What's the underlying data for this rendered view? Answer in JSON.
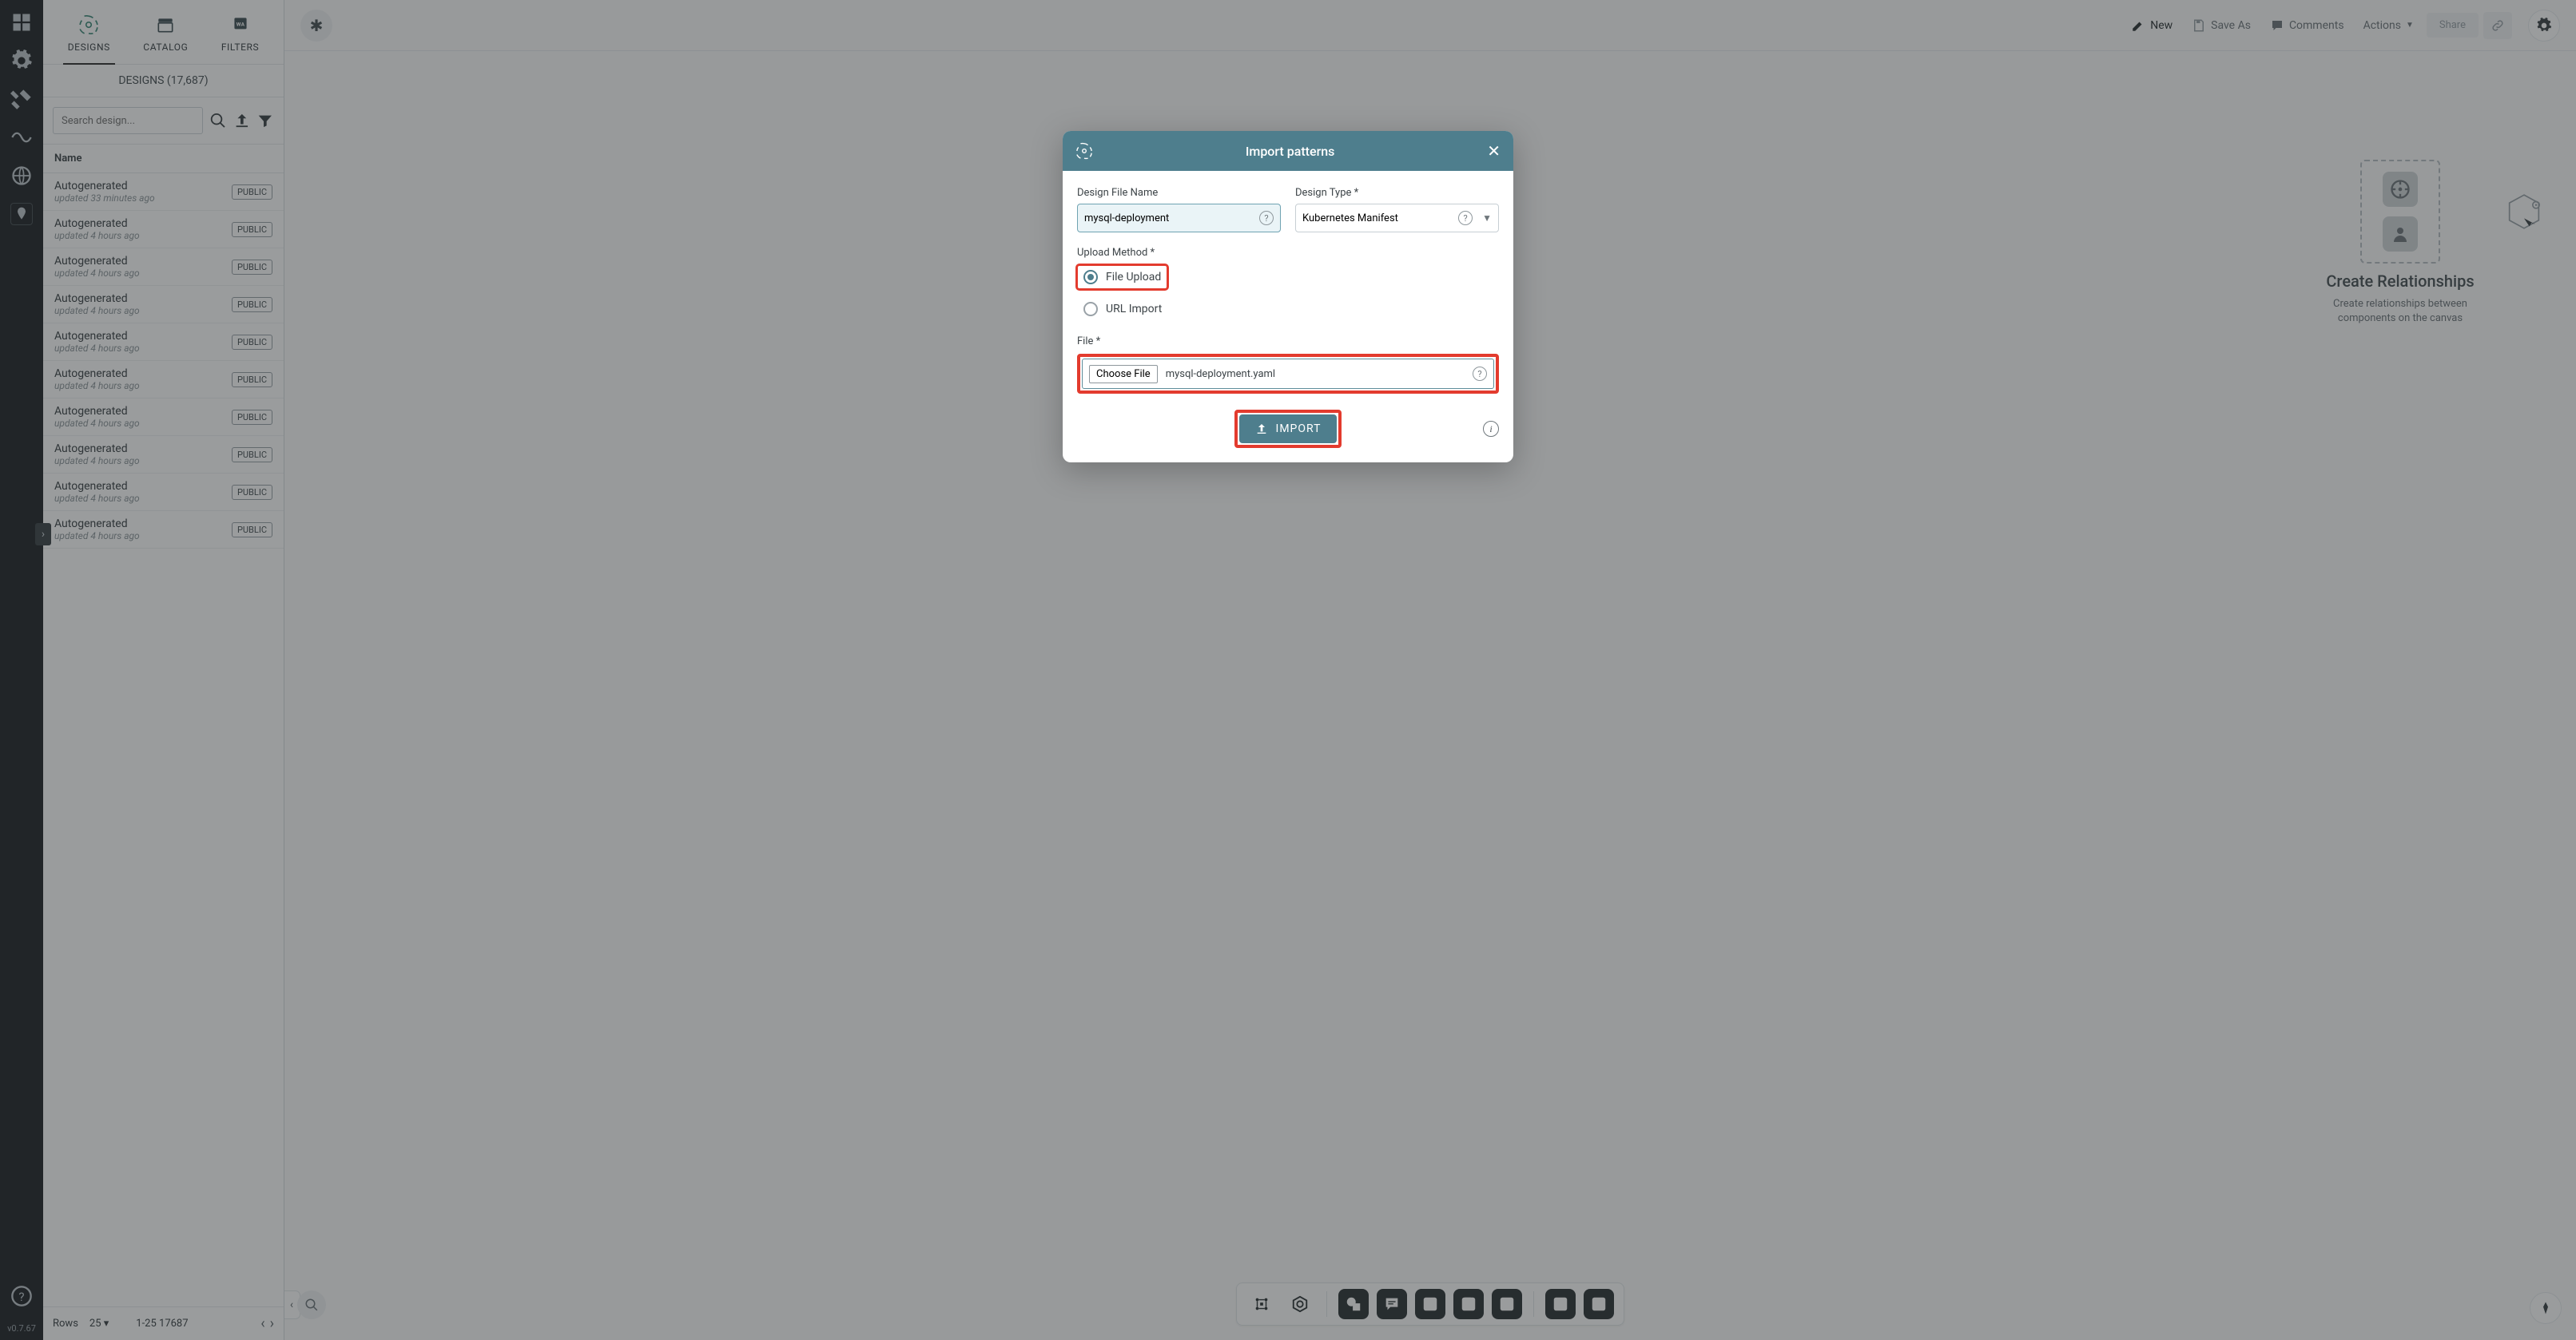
{
  "rail": {
    "version": "v0.7.67"
  },
  "leftPanel": {
    "tabs": {
      "designs": "DESIGNS",
      "catalog": "CATALOG",
      "filters": "FILTERS"
    },
    "countLabel": "DESIGNS (17,687)",
    "searchPlaceholder": "Search design...",
    "listHeader": "Name",
    "items": [
      {
        "name": "Autogenerated",
        "sub": "updated 33 minutes ago",
        "badge": "PUBLIC"
      },
      {
        "name": "Autogenerated",
        "sub": "updated 4 hours ago",
        "badge": "PUBLIC"
      },
      {
        "name": "Autogenerated",
        "sub": "updated 4 hours ago",
        "badge": "PUBLIC"
      },
      {
        "name": "Autogenerated",
        "sub": "updated 4 hours ago",
        "badge": "PUBLIC"
      },
      {
        "name": "Autogenerated",
        "sub": "updated 4 hours ago",
        "badge": "PUBLIC"
      },
      {
        "name": "Autogenerated",
        "sub": "updated 4 hours ago",
        "badge": "PUBLIC"
      },
      {
        "name": "Autogenerated",
        "sub": "updated 4 hours ago",
        "badge": "PUBLIC"
      },
      {
        "name": "Autogenerated",
        "sub": "updated 4 hours ago",
        "badge": "PUBLIC"
      },
      {
        "name": "Autogenerated",
        "sub": "updated 4 hours ago",
        "badge": "PUBLIC"
      },
      {
        "name": "Autogenerated",
        "sub": "updated 4 hours ago",
        "badge": "PUBLIC"
      }
    ],
    "footer": {
      "rowsLabel": "Rows",
      "rowsValue": "25",
      "range": "1-25 17687"
    }
  },
  "topbar": {
    "new": "New",
    "saveAs": "Save As",
    "comments": "Comments",
    "actions": "Actions",
    "share": "Share"
  },
  "hint": {
    "title": "Create Relationships",
    "body": "Create relationships between components on the canvas"
  },
  "modal": {
    "title": "Import patterns",
    "fileNameLabel": "Design File Name",
    "fileNameValue": "mysql-deployment",
    "typeLabel": "Design Type *",
    "typeValue": "Kubernetes Manifest",
    "uploadMethodLabel": "Upload Method *",
    "radioFile": "File Upload",
    "radioUrl": "URL Import",
    "fileLabel": "File *",
    "chooseFile": "Choose File",
    "chosenFile": "mysql-deployment.yaml",
    "importBtn": "IMPORT"
  }
}
